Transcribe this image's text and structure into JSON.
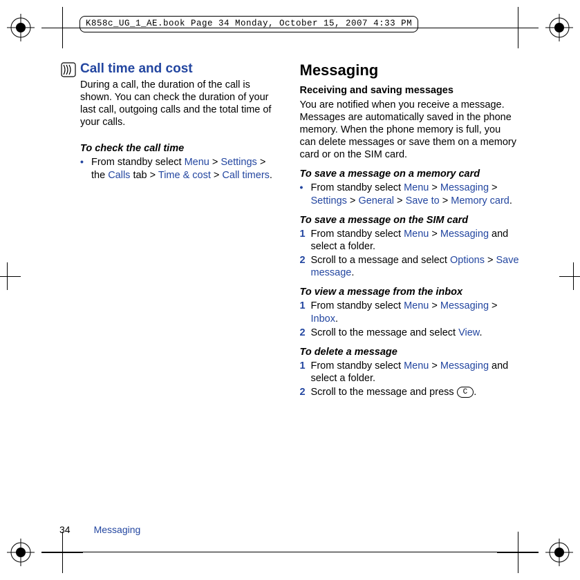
{
  "header": {
    "label": "K858c_UG_1_AE.book  Page 34  Monday, October 15, 2007  4:33 PM"
  },
  "left": {
    "title": "Call time and cost",
    "intro": "During a call, the duration of the call is shown. You can check the duration of your last call, outgoing calls and the total time of your calls.",
    "checkHead": "To check the call time",
    "bullet": {
      "t1": "From standby select ",
      "menu": "Menu",
      "gt": " > ",
      "settings": "Settings",
      "gt2": " > the ",
      "calls": "Calls",
      "t2": " tab > ",
      "time": "Time & cost",
      "gt3": " > ",
      "timers": "Call timers",
      "period": "."
    }
  },
  "right": {
    "title": "Messaging",
    "recvHead": "Receiving and saving messages",
    "recvBody": "You are notified when you receive a message. Messages are automatically saved in the phone memory. When the phone memory is full, you can delete messages or save them on a memory card or on the SIM card.",
    "memHead": "To save a message on a memory card",
    "memBullet": {
      "t1": "From standby select ",
      "menu": "Menu",
      "gt": " > ",
      "msg": "Messaging",
      "gt2": " > ",
      "settings": "Settings",
      "gt3": " > ",
      "general": "General",
      "gt4": " > ",
      "saveto": "Save to",
      "gt5": " > ",
      "memcard": "Memory card",
      "period": "."
    },
    "simHead": "To save a message on the SIM card",
    "sim": {
      "n1": "1",
      "s1a": "From standby select ",
      "menu": "Menu",
      "gt": " >  ",
      "msg": "Messaging",
      "s1b": " and select a folder.",
      "n2": "2",
      "s2a": "Scroll to a message and select ",
      "options": "Options",
      "gt2": " > ",
      "save": "Save message",
      "period": "."
    },
    "viewHead": "To view a message from the inbox",
    "view": {
      "n1": "1",
      "s1a": "From standby select ",
      "menu": "Menu",
      "gt": " >  ",
      "msg": "Messaging",
      "gt2": " > ",
      "inbox": "Inbox",
      "period": ".",
      "n2": "2",
      "s2a": "Scroll to the message and select ",
      "viewLink": "View",
      "period2": "."
    },
    "delHead": "To delete a message",
    "del": {
      "n1": "1",
      "s1a": "From standby select ",
      "menu": "Menu",
      "gt": " > ",
      "msg": "Messaging",
      "s1b": " and select a folder.",
      "n2": "2",
      "s2a": "Scroll to the message and press ",
      "key": "C",
      "period": "."
    }
  },
  "footer": {
    "num": "34",
    "name": "Messaging"
  }
}
